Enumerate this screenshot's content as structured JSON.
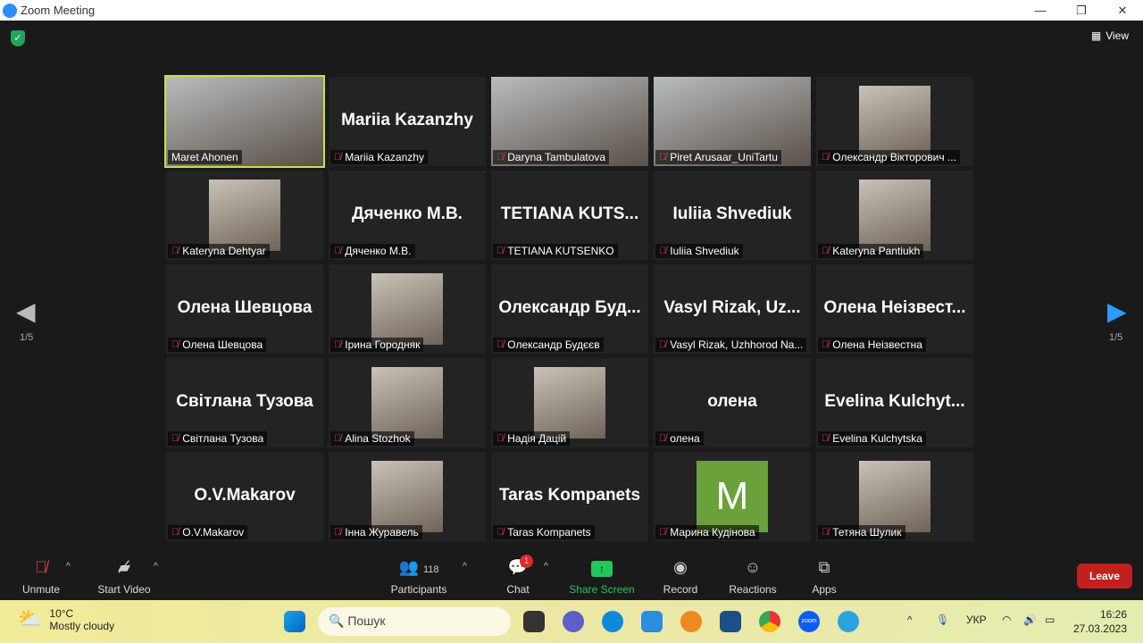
{
  "window": {
    "title": "Zoom Meeting",
    "view_label": "View"
  },
  "tiles": [
    {
      "name": "Maret Ahonen",
      "kind": "video",
      "active": true,
      "muted": false
    },
    {
      "name": "Mariia Kazanzhy",
      "big": "Mariia Kazanzhy",
      "kind": "name",
      "muted": true
    },
    {
      "name": "Daryna Tambulatova",
      "kind": "video",
      "muted": true
    },
    {
      "name": "Piret Arusaar_UniTartu",
      "kind": "video",
      "muted": true
    },
    {
      "name": "Олександр Вікторович ...",
      "kind": "photo",
      "muted": true
    },
    {
      "name": "Kateryna Dehtyar",
      "kind": "photo",
      "muted": true
    },
    {
      "name": "Дяченко М.В.",
      "big": "Дяченко М.В.",
      "kind": "name",
      "muted": true
    },
    {
      "name": "TETIANA KUTSENKO",
      "big": "TETIANA  KUTS...",
      "kind": "name",
      "muted": true
    },
    {
      "name": "Iuliia Shvediuk",
      "big": "Iuliia Shvediuk",
      "kind": "name",
      "muted": true
    },
    {
      "name": "Kateryna Pantiukh",
      "kind": "photo",
      "muted": true
    },
    {
      "name": "Олена Шевцова",
      "big": "Олена Шевцова",
      "kind": "name",
      "muted": true
    },
    {
      "name": "Ірина Городняк",
      "kind": "photo",
      "muted": true
    },
    {
      "name": "Олександр Будєєв",
      "big": "Олександр  Буд...",
      "kind": "name",
      "muted": true
    },
    {
      "name": "Vasyl Rizak, Uzhhorod Na...",
      "big": "Vasyl  Rizak,  Uz...",
      "kind": "name",
      "muted": true
    },
    {
      "name": "Олена Неізвестна",
      "big": "Олена  Неізвест...",
      "kind": "name",
      "muted": true
    },
    {
      "name": "Світлана Тузова",
      "big": "Світлана Тузова",
      "kind": "name",
      "muted": true
    },
    {
      "name": "Alina Stozhok",
      "kind": "photo",
      "muted": true
    },
    {
      "name": "Надія Дацій",
      "kind": "photo",
      "muted": true
    },
    {
      "name": "олена",
      "big": "олена",
      "kind": "name",
      "muted": true
    },
    {
      "name": "Evelina Kulchytska",
      "big": "Evelina  Kulchyt...",
      "kind": "name",
      "muted": true
    },
    {
      "name": "O.V.Makarov",
      "big": "O.V.Makarov",
      "kind": "name",
      "muted": true
    },
    {
      "name": "Інна Журавель",
      "kind": "photo",
      "muted": true
    },
    {
      "name": "Taras Kompanets",
      "big": "Taras Kompanets",
      "kind": "name",
      "muted": true
    },
    {
      "name": "Марина Кудінова",
      "kind": "avatar",
      "initial": "M",
      "muted": true
    },
    {
      "name": "Тетяна Шулик",
      "kind": "photo",
      "muted": true
    }
  ],
  "pagination": {
    "left": "1/5",
    "right": "1/5"
  },
  "toolbar": {
    "unmute": "Unmute",
    "start_video": "Start Video",
    "participants": "Participants",
    "participants_count": "118",
    "chat": "Chat",
    "chat_badge": "1",
    "share_screen": "Share Screen",
    "record": "Record",
    "reactions": "Reactions",
    "apps": "Apps",
    "leave": "Leave"
  },
  "taskbar": {
    "temp": "10°C",
    "weather": "Mostly cloudy",
    "search_placeholder": "Пошук",
    "lang": "УКР",
    "time": "16:26",
    "date": "27.03.2023"
  },
  "colors": {
    "accent_green": "#23c65a",
    "leave_red": "#c2201e",
    "active_border": "#c7e04a"
  }
}
